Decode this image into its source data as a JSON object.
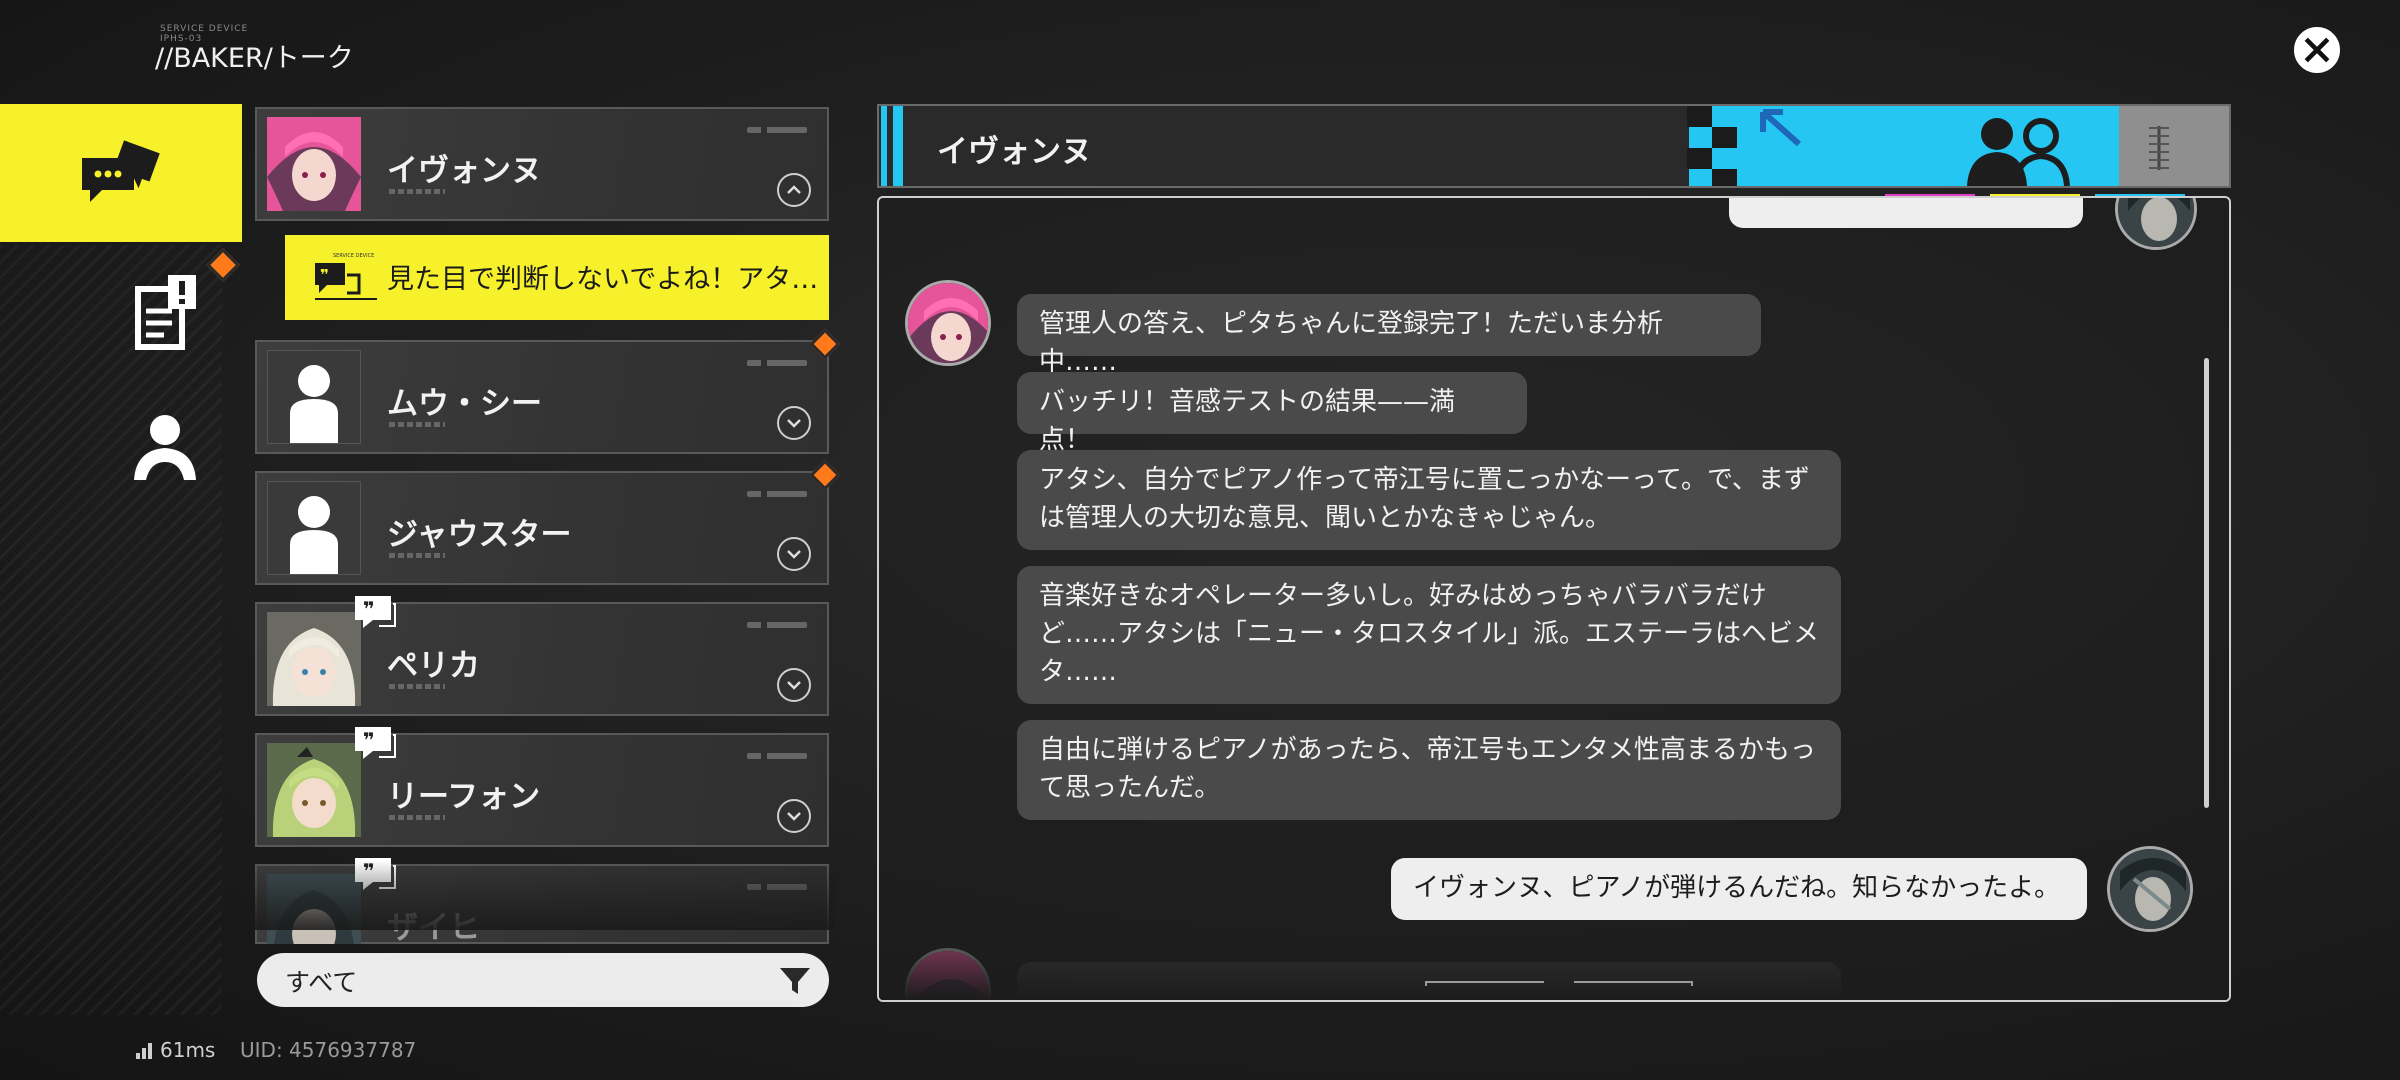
{
  "header": {
    "subtitle_line1": "SERVICE DEVICE",
    "subtitle_line2": "IPHS-03",
    "title": "//BAKER/トーク",
    "close_icon": "close-x-icon"
  },
  "rail": {
    "items": [
      {
        "name": "talk",
        "icon": "chat-bubbles-icon",
        "active": true
      },
      {
        "name": "tasks",
        "icon": "notice-document-icon",
        "active": false,
        "has_notification": true
      },
      {
        "name": "contacts",
        "icon": "person-icon",
        "active": false
      }
    ]
  },
  "contacts": [
    {
      "name": "イヴォンヌ",
      "expanded": true,
      "avatar": "pink-hair-avatar"
    },
    {
      "name": "ムウ・シー",
      "avatar": "silhouette",
      "has_notification": true
    },
    {
      "name": "ジャウスター",
      "avatar": "silhouette",
      "has_notification": true
    },
    {
      "name": "ペリカ",
      "avatar": "white-hair-avatar",
      "has_quote": true
    },
    {
      "name": "リーフォン",
      "avatar": "green-hair-avatar",
      "has_quote": true
    },
    {
      "name": "ザイヒ",
      "avatar": "dark-avatar",
      "has_quote": true
    }
  ],
  "preview": {
    "text": "見た目で判断しないでよね！アタ…"
  },
  "filter": {
    "label": "すべて",
    "icon": "filter-funnel-icon"
  },
  "status": {
    "ping": "61ms",
    "uid": "UID: 4576937787"
  },
  "chat": {
    "partner_name": "イヴォンヌ",
    "accent_color": "#26c6f2",
    "highlight_color": "#f6f12a",
    "messages": [
      {
        "from": "partner",
        "text": "管理人の答え、ピタちゃんに登録完了！ただいま分析中……"
      },
      {
        "from": "partner",
        "text": "バッチリ！音感テストの結果——満点！"
      },
      {
        "from": "partner",
        "text": "アタシ、自分でピアノ作って帝江号に置こっかなーって。で、まずは管理人の大切な意見、聞いとかなきゃじゃん。"
      },
      {
        "from": "partner",
        "text": "音楽好きなオペレーター多いし。好みはめっちゃバラバラだけど……アタシは「ニュー・タロスタイル」派。エステーラはヘビメタ……"
      },
      {
        "from": "partner",
        "text": "自由に弾けるピアノがあったら、帝江号もエンタメ性高まるかもって思ったんだ。"
      },
      {
        "from": "self",
        "text": "イヴォンヌ、ピアノが弾けるんだね。知らなかったよ。"
      }
    ]
  }
}
